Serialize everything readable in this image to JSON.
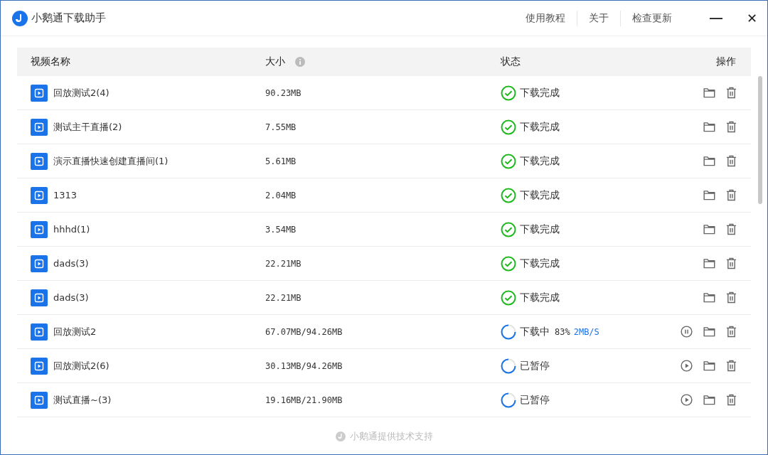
{
  "window": {
    "title": "小鹅通下载助手"
  },
  "menu": [
    "使用教程",
    "关于",
    "检查更新"
  ],
  "window_controls": {
    "minimize": "—",
    "close": "✕"
  },
  "table": {
    "columns": [
      "视频名称",
      "大小",
      "状态",
      "操作"
    ],
    "rows": [
      {
        "name": "回放测试2(4)",
        "size": "90.23MB",
        "kind": "done",
        "status": "下载完成"
      },
      {
        "name": "测试主干直播(2)",
        "size": "7.55MB",
        "kind": "done",
        "status": "下载完成"
      },
      {
        "name": "演示直播快速创建直播间(1)",
        "size": "5.61MB",
        "kind": "done",
        "status": "下载完成"
      },
      {
        "name": "1313",
        "size": "2.04MB",
        "kind": "done",
        "status": "下载完成"
      },
      {
        "name": "hhhd(1)",
        "size": "3.54MB",
        "kind": "done",
        "status": "下载完成"
      },
      {
        "name": "dads(3)",
        "size": "22.21MB",
        "kind": "done",
        "status": "下载完成"
      },
      {
        "name": "dads(3)",
        "size": "22.21MB",
        "kind": "done",
        "status": "下载完成"
      },
      {
        "name": "回放测试2",
        "size": "67.07MB/94.26MB",
        "kind": "downloading",
        "status": "下载中",
        "percent": "83%",
        "speed": "2MB/S"
      },
      {
        "name": "回放测试2(6)",
        "size": "30.13MB/94.26MB",
        "kind": "paused",
        "status": "已暂停"
      },
      {
        "name": "测试直播~(3)",
        "size": "19.16MB/21.90MB",
        "kind": "paused",
        "status": "已暂停"
      }
    ]
  },
  "footer": "小鹅通提供技术支持"
}
